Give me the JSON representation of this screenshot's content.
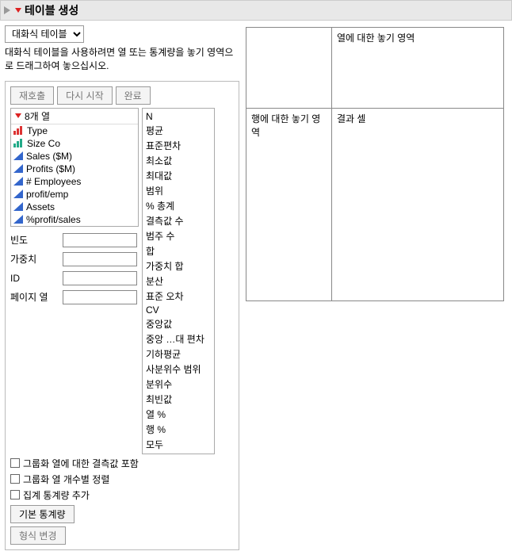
{
  "header": {
    "title": "테이블 생성"
  },
  "mode_select": {
    "value": "대화식 테이블"
  },
  "instruction": "대화식 테이블을 사용하려면 열 또는 통계량을 놓기 영역으로 드래그하여 놓으십시오.",
  "buttons": {
    "resubmit": "재호출",
    "restart": "다시 시작",
    "done": "완료"
  },
  "columns_header": "8개 열",
  "columns": [
    {
      "name": "Type",
      "icon": "bars-red"
    },
    {
      "name": "Size Co",
      "icon": "bars-green"
    },
    {
      "name": "Sales ($M)",
      "icon": "tri-blue"
    },
    {
      "name": "Profits ($M)",
      "icon": "tri-blue"
    },
    {
      "name": "# Employees",
      "icon": "tri-blue"
    },
    {
      "name": "profit/emp",
      "icon": "tri-blue"
    },
    {
      "name": "Assets",
      "icon": "tri-blue"
    },
    {
      "name": "%profit/sales",
      "icon": "tri-blue"
    }
  ],
  "statistics": [
    "N",
    "평균",
    "표준편차",
    "최소값",
    "최대값",
    "범위",
    "% 총계",
    "결측값 수",
    "범주 수",
    "합",
    "가중치 합",
    "분산",
    "표준 오차",
    "CV",
    "중앙값",
    "중앙 …대 편차",
    "기하평균",
    "사분위수 범위",
    "분위수",
    "최빈값",
    "열 %",
    "행 %",
    "모두"
  ],
  "fields": {
    "freq": {
      "label": "빈도",
      "value": ""
    },
    "weight": {
      "label": "가중치",
      "value": ""
    },
    "id": {
      "label": "ID",
      "value": ""
    },
    "pagecol": {
      "label": "페이지 열",
      "value": ""
    }
  },
  "checks": {
    "include_missing": "그룹화 열에 대한 결측값 포함",
    "order_by_count": "그룹화 열 개수별 정렬",
    "add_aggregate": "집계 통계량 추가"
  },
  "footer_buttons": {
    "default_stats": "기본 통계량",
    "change_format": "형식 변경"
  },
  "dropzones": {
    "col_drop": "열에 대한 놓기 영역",
    "row_drop": "행에 대한 놓기 영역",
    "result_cell": "결과 셀"
  }
}
